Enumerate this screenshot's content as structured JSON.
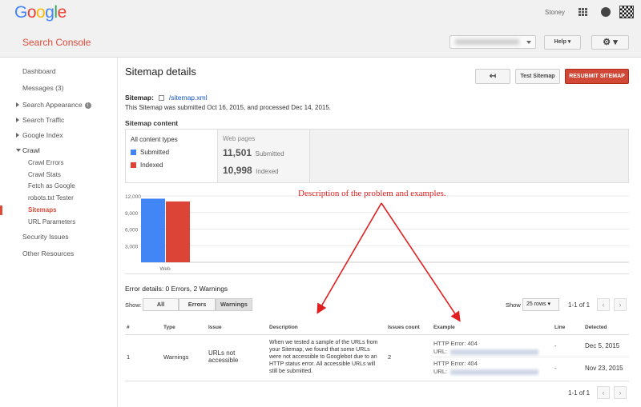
{
  "header": {
    "logo": "Google",
    "user_name": "Stoney",
    "product_name": "Search Console",
    "help_label": "Help",
    "gear_label": "⚙"
  },
  "sidebar": {
    "items": [
      {
        "label": "Dashboard"
      },
      {
        "label": "Messages (3)"
      },
      {
        "label": "Search Appearance"
      },
      {
        "label": "Search Traffic"
      },
      {
        "label": "Google Index"
      },
      {
        "label": "Crawl"
      },
      {
        "label": "Crawl Errors"
      },
      {
        "label": "Crawl Stats"
      },
      {
        "label": "Fetch as Google"
      },
      {
        "label": "robots.txt Tester"
      },
      {
        "label": "Sitemaps"
      },
      {
        "label": "URL Parameters"
      },
      {
        "label": "Security Issues"
      },
      {
        "label": "Other Resources"
      }
    ]
  },
  "page": {
    "title": "Sitemap details",
    "back_label": "↤",
    "test_label": "Test Sitemap",
    "resubmit_label": "RESUBMIT SITEMAP",
    "sitemap_label": "Sitemap:",
    "sitemap_link": "/sitemap.xml",
    "submitted_info": "This Sitemap was submitted Oct 16, 2015, and processed Dec 14, 2015.",
    "content_title": "Sitemap content",
    "all_types": "All content types",
    "submitted": "Submitted",
    "indexed": "Indexed",
    "web_pages": "Web pages",
    "submitted_count": "11,501",
    "submitted_word": "Submitted",
    "indexed_count": "10,998",
    "indexed_word": "Indexed"
  },
  "chart_data": {
    "type": "bar",
    "categories": [
      "Web"
    ],
    "series": [
      {
        "name": "Submitted",
        "values": [
          11501
        ],
        "color": "#4285f4"
      },
      {
        "name": "Indexed",
        "values": [
          10998
        ],
        "color": "#db4437"
      }
    ],
    "yticks": [
      "12,000",
      "9,000",
      "6,000",
      "3,000"
    ],
    "ylim": [
      0,
      12000
    ]
  },
  "annotation": "Description of the problem and examples.",
  "errors": {
    "heading": "Error details: 0 Errors, 2 Warnings",
    "show_label": "Show:",
    "filters": [
      "All",
      "Errors",
      "Warnings"
    ],
    "rows_label": "Show",
    "rows_value": "25 rows",
    "pager_text": "1-1 of 1",
    "columns": [
      "#",
      "Type",
      "Issue",
      "Description",
      "Issues count",
      "Example",
      "Line",
      "Detected"
    ],
    "row": {
      "num": "1",
      "type": "Warnings",
      "issue": "URLs not accessible",
      "description": "When we tested a sample of the URLs from your Sitemap, we found that some URLs were not accessible to Googlebot due to an HTTP status error. All accessible URLs will still be submitted.",
      "count": "2",
      "examples": [
        {
          "error": "HTTP Error: 404",
          "url_label": "URL:",
          "line": "-",
          "detected": "Dec 5, 2015"
        },
        {
          "error": "HTTP Error: 404",
          "url_label": "URL:",
          "line": "-",
          "detected": "Nov 23, 2015"
        }
      ]
    }
  },
  "colors": {
    "accent": "#dd4b39",
    "submitted": "#4285f4",
    "indexed": "#db4437",
    "annotation": "#e02020"
  }
}
